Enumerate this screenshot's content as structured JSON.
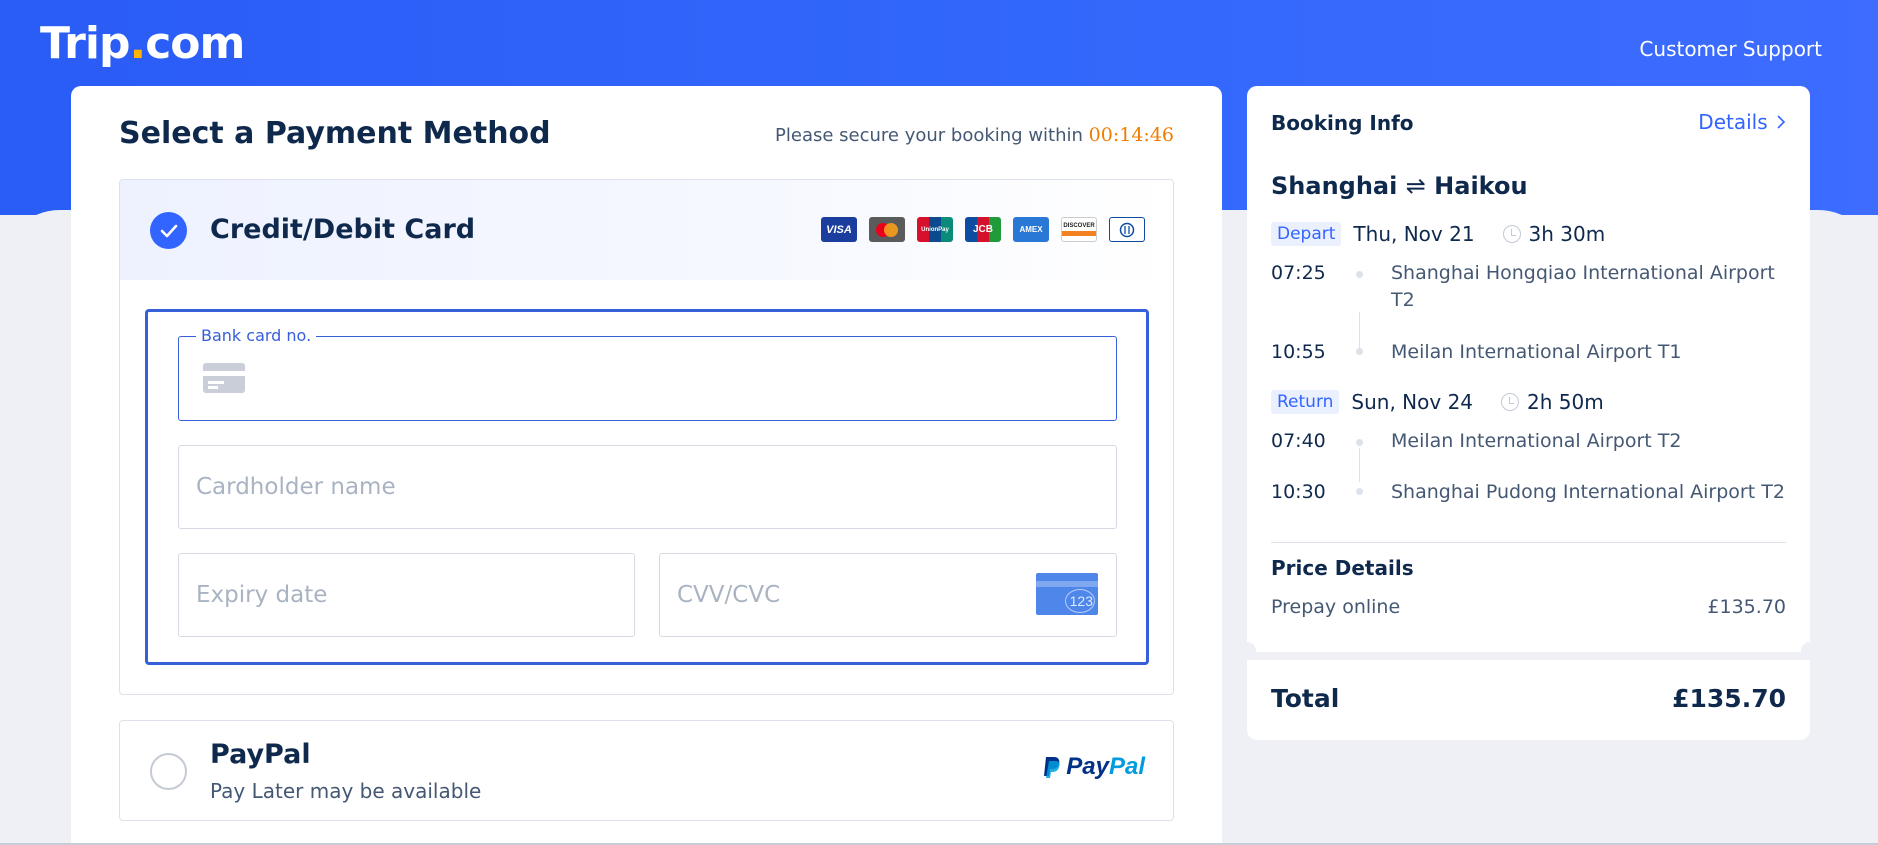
{
  "header": {
    "logo_main": "Trip",
    "logo_dot": ".",
    "logo_suffix": "com",
    "support_label": "Customer Support"
  },
  "payment": {
    "title": "Select a Payment Method",
    "secure_text": "Please secure your booking within ",
    "timer": "00:14:46",
    "card": {
      "title": "Credit/Debit Card",
      "brands": [
        "VISA",
        "mastercard",
        "UnionPay",
        "JCB",
        "AMEX",
        "DISCOVER",
        "Diners"
      ],
      "bank_card_label": "Bank card no.",
      "bank_card_value": "",
      "cardholder_placeholder": "Cardholder name",
      "expiry_placeholder": "Expiry date",
      "cvv_placeholder": "CVV/CVC",
      "cvv_hint_number": "123"
    },
    "paypal": {
      "title": "PayPal",
      "subtitle": "Pay Later may be available",
      "logo_text_1": "Pay",
      "logo_text_2": "Pal"
    }
  },
  "booking": {
    "title": "Booking Info",
    "details_link": "Details",
    "route_from": "Shanghai",
    "route_symbol": "⇌",
    "route_to": "Haikou",
    "depart": {
      "tag": "Depart",
      "date": "Thu, Nov 21",
      "duration": "3h 30m",
      "dep_time": "07:25",
      "dep_airport": "Shanghai Hongqiao International Airport T2",
      "arr_time": "10:55",
      "arr_airport": "Meilan International Airport T1"
    },
    "return": {
      "tag": "Return",
      "date": "Sun, Nov 24",
      "duration": "2h 50m",
      "dep_time": "07:40",
      "dep_airport": "Meilan International Airport T2",
      "arr_time": "10:30",
      "arr_airport": "Shanghai Pudong International Airport T2"
    },
    "price_title": "Price Details",
    "prepay_label": "Prepay online",
    "prepay_value": "£135.70",
    "total_label": "Total",
    "total_value": "£135.70"
  },
  "colors": {
    "brand_blue": "#3264ff",
    "timer_orange": "#f07d00",
    "logo_dot": "#ffb400"
  }
}
